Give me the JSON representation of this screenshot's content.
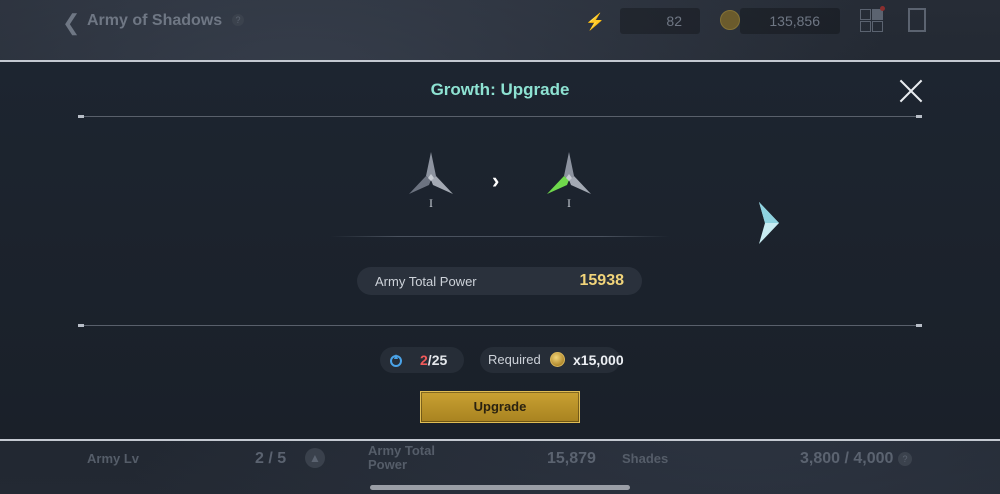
{
  "header": {
    "title": "Army of Shadows",
    "help": "?",
    "energy": "82",
    "gold": "135,856"
  },
  "modal": {
    "title": "Growth: Upgrade",
    "current_level": "I",
    "next_level": "I",
    "power_label": "Army Total Power",
    "power_value": "15938",
    "material_current": "2",
    "material_sep": "/",
    "material_required": "25",
    "required_label": "Required",
    "required_amount": "x15,000",
    "upgrade_label": "Upgrade"
  },
  "footer": {
    "army_lv_label": "Army Lv",
    "army_lv_value": "2 / 5",
    "power_label": "Army Total Power",
    "power_value": "15,879",
    "shades_label": "Shades",
    "shades_value": "3,800 / 4,000",
    "help": "?"
  },
  "colors": {
    "title_accent": "#8ee2d2",
    "power_value": "#f1d47a",
    "material_short": "#f05a5a",
    "button": "#c9a132",
    "green_shard": "#6fd84c"
  },
  "icons": [
    "back-chevron-icon",
    "energy-icon",
    "gold-coin-icon",
    "grid-menu-icon",
    "exit-door-icon",
    "close-icon",
    "tri-blade-emblem-icon",
    "chevron-right-icon",
    "next-arrow-icon",
    "blue-flame-icon"
  ]
}
